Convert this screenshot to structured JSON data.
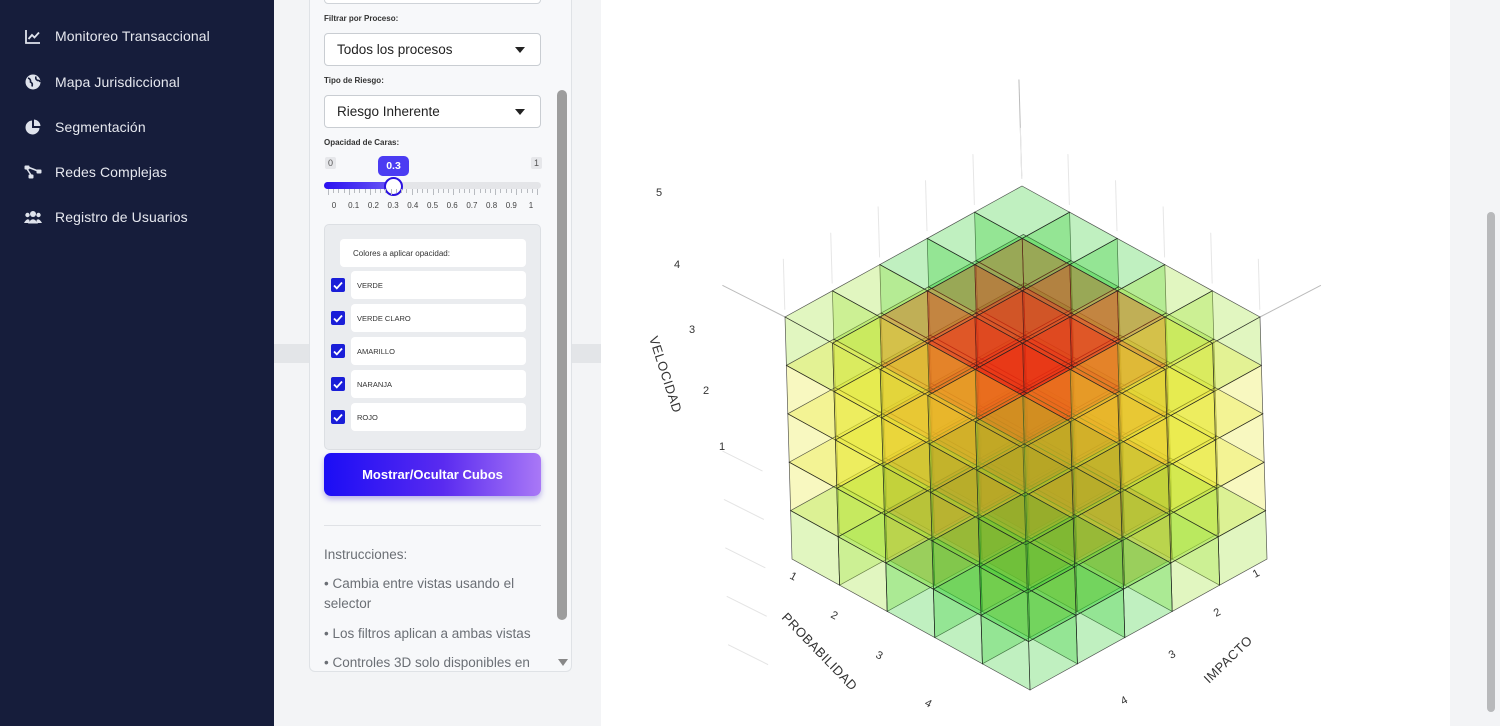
{
  "sidebar": {
    "items": [
      {
        "label": "Monitoreo Transaccional",
        "icon": "line-chart-icon"
      },
      {
        "label": "Mapa Jurisdiccional",
        "icon": "globe-icon"
      },
      {
        "label": "Segmentación",
        "icon": "pie-chart-icon"
      },
      {
        "label": "Redes Complejas",
        "icon": "network-icon"
      },
      {
        "label": "Registro de Usuarios",
        "icon": "users-icon"
      }
    ]
  },
  "controls": {
    "process_filter": {
      "label": "Filtrar por Proceso:",
      "value": "Todos los procesos"
    },
    "risk_type": {
      "label": "Tipo de Riesgo:",
      "value": "Riesgo Inherente"
    },
    "opacity": {
      "label": "Opacidad de Caras:",
      "min": "0",
      "max": "1",
      "value": "0.3",
      "fraction": 0.3,
      "ticks": [
        "0",
        "0.1",
        "0.2",
        "0.3",
        "0.4",
        "0.5",
        "0.6",
        "0.7",
        "0.8",
        "0.9",
        "1"
      ]
    },
    "colors": {
      "title": "Colores a aplicar opacidad:",
      "options": [
        {
          "label": "VERDE",
          "checked": true
        },
        {
          "label": "VERDE CLARO",
          "checked": true
        },
        {
          "label": "AMARILLO",
          "checked": true
        },
        {
          "label": "NARANJA",
          "checked": true
        },
        {
          "label": "ROJO",
          "checked": true
        }
      ]
    },
    "toggle_button": "Mostrar/Ocultar Cubos",
    "instructions": {
      "title": "Instrucciones:",
      "lines": [
        "• Cambia entre vistas usando el selector",
        "• Los filtros aplican a ambas vistas",
        "• Controles 3D solo disponibles en"
      ]
    }
  },
  "chart_data": {
    "type": "3d-cube",
    "axes": {
      "z_label": "VELOCIDAD",
      "x_label": "PROBABILIDAD",
      "y_label": "IMPACTO",
      "z_ticks": [
        "1",
        "2",
        "3",
        "4",
        "5"
      ],
      "x_ticks": [
        "1",
        "2",
        "3",
        "4"
      ],
      "y_ticks": [
        "1",
        "2",
        "3",
        "4"
      ]
    },
    "grid_size": 5,
    "colors": {
      "verde": "#2ecc2e",
      "verde_claro": "#9be22e",
      "amarillo": "#e8e830",
      "naranja": "#f0a020",
      "rojo": "#ef2a12"
    }
  },
  "theme": {
    "sidebar_bg": "#161d3b",
    "accent": "#2a10f0"
  }
}
